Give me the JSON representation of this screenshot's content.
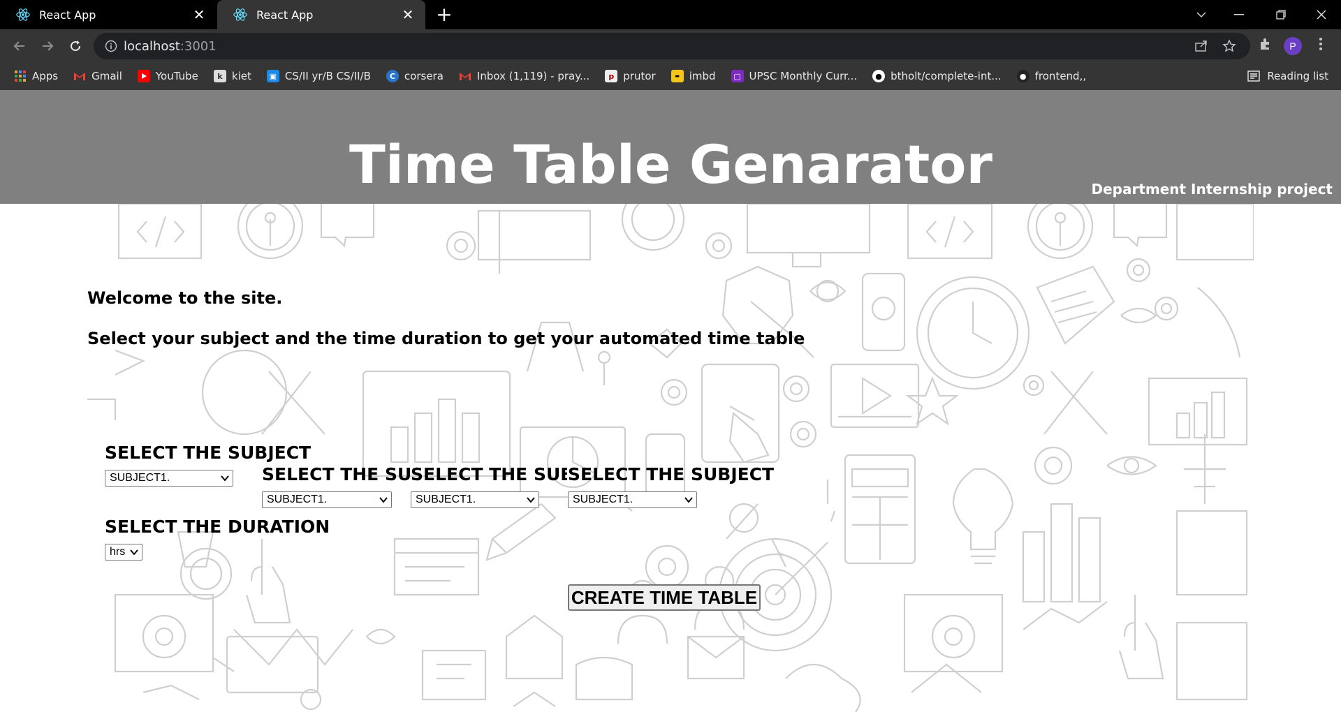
{
  "browser": {
    "tabs": [
      {
        "title": "React App",
        "active": false
      },
      {
        "title": "React App",
        "active": true
      }
    ],
    "url_host": "localhost",
    "url_port": ":3001",
    "profile_initial": "P",
    "bookmarks": [
      {
        "label": "Apps",
        "icon": "apps-grid-icon"
      },
      {
        "label": "Gmail",
        "icon": "gmail-icon"
      },
      {
        "label": "YouTube",
        "icon": "youtube-icon"
      },
      {
        "label": "kiet",
        "icon": "kiet-icon"
      },
      {
        "label": "CS/II yr/B CS/II/B",
        "icon": "classroom-icon"
      },
      {
        "label": "corsera",
        "icon": "coursera-icon"
      },
      {
        "label": "Inbox (1,119) - pray...",
        "icon": "gmail-icon"
      },
      {
        "label": "prutor",
        "icon": "prutor-icon"
      },
      {
        "label": "imbd",
        "icon": "imdb-icon"
      },
      {
        "label": "UPSC Monthly Curr...",
        "icon": "upsc-icon"
      },
      {
        "label": "btholt/complete-int...",
        "icon": "github-icon"
      },
      {
        "label": "frontend,,",
        "icon": "github-icon"
      }
    ],
    "reading_list": "Reading list"
  },
  "header": {
    "title": "Time Table Genarator",
    "subtitle": "Department Internship project"
  },
  "main": {
    "welcome": "Welcome to the site.",
    "instructions": "Select your subject and the time duration to get your automated time table",
    "subject_label": "SELECT THE SUBJECT",
    "subject_selects": [
      {
        "value": "SUBJECT1."
      },
      {
        "value": "SUBJECT1."
      },
      {
        "value": "SUBJECT1."
      },
      {
        "value": "SUBJECT1."
      }
    ],
    "duration_label": "SELECT THE DURATION",
    "duration_value": "hrs",
    "create_button": "CREATE TIME TABLE"
  },
  "colors": {
    "header_bg": "#808080",
    "chrome_bg": "#353535",
    "tabstrip_bg": "#000000"
  }
}
